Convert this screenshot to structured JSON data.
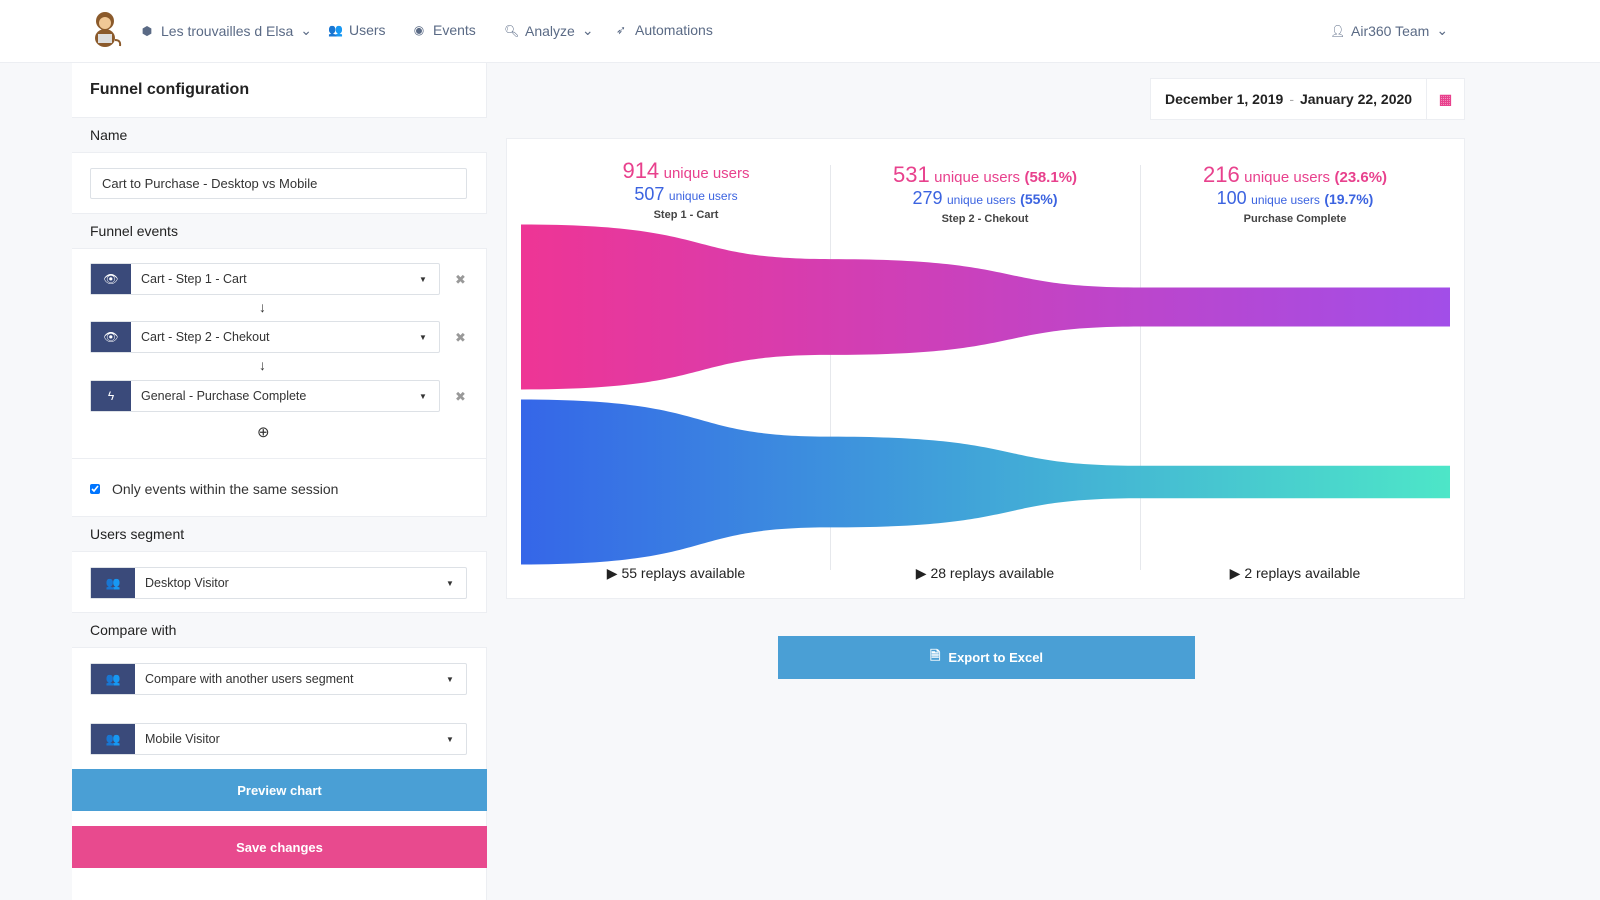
{
  "nav": {
    "project": "Les trouvailles d Elsa",
    "users": "Users",
    "events": "Events",
    "analyze": "Analyze",
    "automations": "Automations",
    "account": "Air360 Team"
  },
  "sidebar": {
    "title": "Funnel configuration",
    "name_label": "Name",
    "name_value": "Cart to Purchase - Desktop vs Mobile",
    "events_label": "Funnel events",
    "events": [
      {
        "label": "Cart - Step 1 - Cart",
        "icon": "eye-icon"
      },
      {
        "label": "Cart - Step 2 - Chekout",
        "icon": "eye-icon"
      },
      {
        "label": "General - Purchase Complete",
        "icon": "bolt-icon"
      }
    ],
    "same_session": "Only events within the same session",
    "same_session_checked": true,
    "segment_label": "Users segment",
    "segment_value": "Desktop Visitor",
    "compare_label": "Compare with",
    "compare_value": "Compare with another users segment",
    "compare_segment": "Mobile Visitor",
    "preview": "Preview chart",
    "save": "Save changes"
  },
  "date": {
    "start": "December 1, 2019",
    "sep": "-",
    "end": "January 22, 2020"
  },
  "export": "Export to Excel",
  "colors": {
    "pink_start": "#ee3595",
    "pink_end": "#a24ee8",
    "blue_start": "#3566e8",
    "blue_end": "#4de6c8",
    "preview": "#4a9fd5",
    "save": "#e84a8e"
  },
  "chart_data": {
    "type": "funnel",
    "unit": "unique users",
    "categories": [
      "Step 1 - Cart",
      "Step 2 - Chekout",
      "Purchase Complete"
    ],
    "series": [
      {
        "values": [
          914,
          531,
          216
        ],
        "pct": [
          "",
          "(58.1%)",
          "(23.6%)"
        ]
      },
      {
        "values": [
          507,
          279,
          100
        ],
        "pct": [
          "",
          "(55%)",
          "(19.7%)"
        ]
      }
    ],
    "replays": [
      "55 replays available",
      "28 replays available",
      "2 replays available"
    ]
  }
}
